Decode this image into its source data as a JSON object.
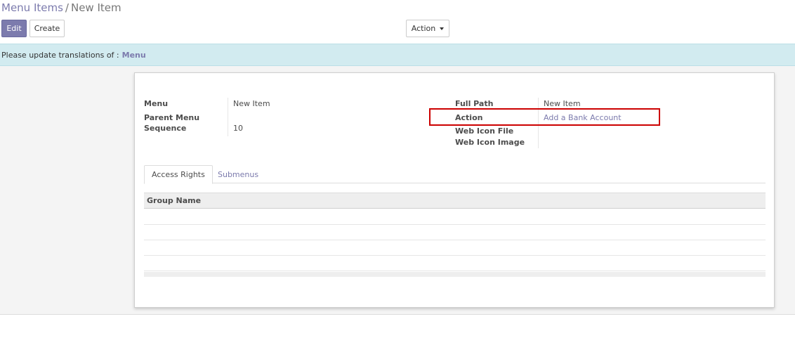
{
  "breadcrumb": {
    "parent": "Menu Items",
    "separator": "/",
    "current": "New Item"
  },
  "toolbar": {
    "edit_label": "Edit",
    "create_label": "Create",
    "action_label": "Action"
  },
  "alert": {
    "message": "Please update translations of :",
    "link": "Menu"
  },
  "form": {
    "left": {
      "menu_label": "Menu",
      "menu_value": "New Item",
      "parent_menu_label": "Parent Menu",
      "parent_menu_value": "",
      "sequence_label": "Sequence",
      "sequence_value": "10"
    },
    "right": {
      "full_path_label": "Full Path",
      "full_path_value": "New Item",
      "action_label": "Action",
      "action_value": "Add a Bank Account",
      "web_icon_file_label": "Web Icon File",
      "web_icon_file_value": "",
      "web_icon_image_label": "Web Icon Image",
      "web_icon_image_value": ""
    }
  },
  "tabs": [
    {
      "label": "Access Rights",
      "active": true
    },
    {
      "label": "Submenus",
      "active": false
    }
  ],
  "table": {
    "columns": [
      "Group Name"
    ],
    "rows": [
      [
        ""
      ],
      [
        ""
      ],
      [
        ""
      ],
      [
        ""
      ]
    ]
  },
  "colors": {
    "primary": "#7c7bad",
    "alert_bg": "#d2ebf0",
    "highlight": "#cc0000"
  }
}
